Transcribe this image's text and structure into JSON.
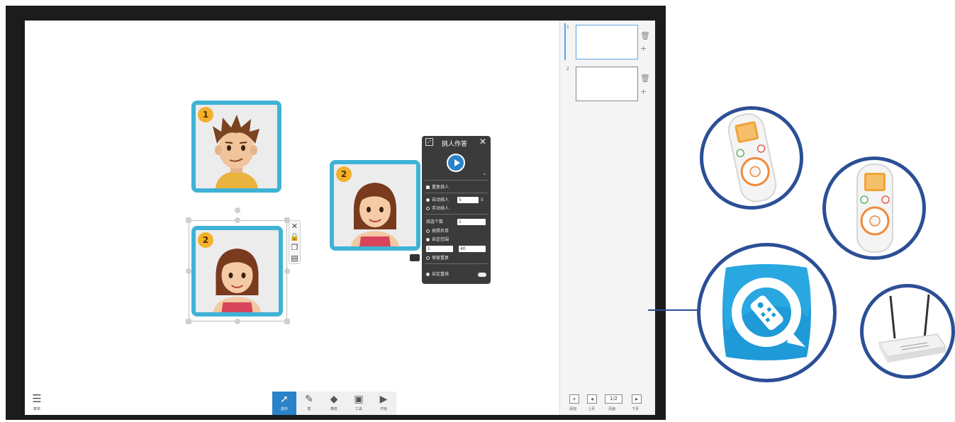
{
  "cards": [
    {
      "badge": "1",
      "character": "boy-avatar"
    },
    {
      "badge": "2",
      "character": "girl-avatar"
    },
    {
      "badge": "2",
      "character": "girl-avatar"
    }
  ],
  "object_tools": {
    "close": "✕",
    "lock": "🔒",
    "copy": "❐",
    "layer": "▤"
  },
  "dialog": {
    "title": "挑人作答",
    "close": "✕",
    "repeat_label": "重复挑人",
    "auto_label": "自动挑人",
    "auto_value": "5",
    "auto_unit": "S",
    "manual_label": "手动挑人",
    "select_label": "挑选个数",
    "select_value": "1",
    "roster_label": "按照名单",
    "range_label": "自定范围",
    "range_from": "1",
    "range_to": "40",
    "keep_label": "保留重复",
    "custom_label": "自定重挑"
  },
  "toolbar": {
    "menu": "菜单",
    "tools": [
      {
        "icon": "cursor-icon",
        "glyph": "➚",
        "label": "选中"
      },
      {
        "icon": "pen-icon",
        "glyph": "✎",
        "label": "笔"
      },
      {
        "icon": "eraser-icon",
        "glyph": "◆",
        "label": "橡皮"
      },
      {
        "icon": "toolbox-icon",
        "glyph": "▣",
        "label": "工具"
      },
      {
        "icon": "play-icon",
        "glyph": "▶",
        "label": "开始"
      }
    ]
  },
  "pages_panel": {
    "pages": [
      {
        "number": "1"
      },
      {
        "number": "2"
      }
    ],
    "delete_glyph": "🗑",
    "add_glyph": "+",
    "add_page_label": "添加",
    "prev_label": "上页",
    "page_display": "1/2",
    "page_list_label": "页面",
    "next_label": "下页"
  }
}
